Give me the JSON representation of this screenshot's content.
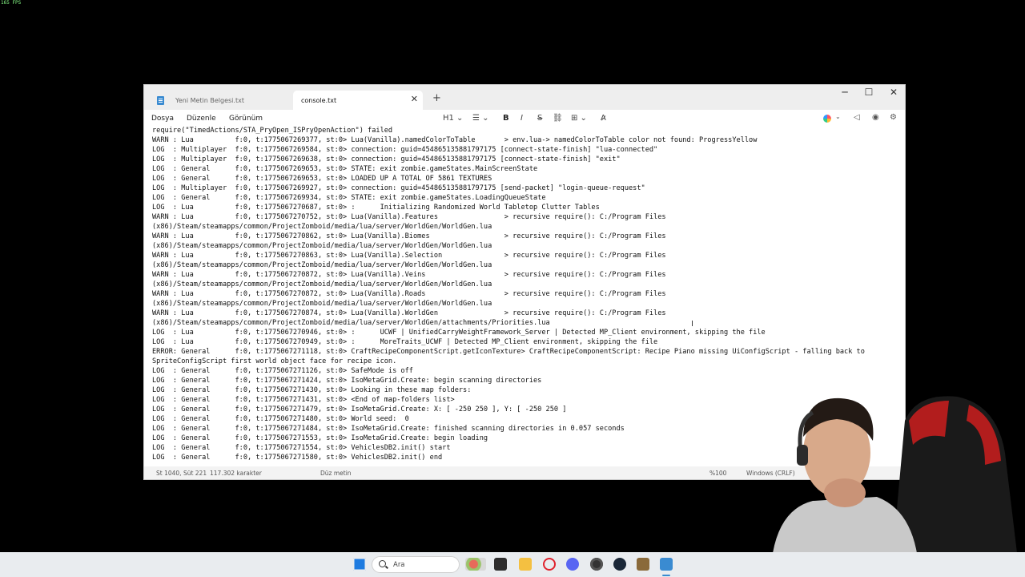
{
  "overlay": {
    "fps": "165 FPS"
  },
  "window": {
    "tabs": [
      {
        "label": "Yeni Metin Belgesi.txt",
        "active": false
      },
      {
        "label": "console.txt",
        "active": true
      }
    ],
    "new_tab_label": "+",
    "controls": {
      "minimize": "─",
      "maximize": "☐",
      "close": "✕"
    }
  },
  "menubar": {
    "items": [
      "Dosya",
      "Düzenle",
      "Görünüm"
    ],
    "toolbar": {
      "heading": "H1 ⌄",
      "list": "☰ ⌄",
      "bold": "B",
      "italic": "I",
      "strike": "S",
      "link": "⛓",
      "table": "⊞ ⌄",
      "clear_format": "A̷"
    },
    "right_icons": {
      "copilot_caret": "⌄",
      "feedback": "◁",
      "account": "◉",
      "settings": "⚙"
    }
  },
  "document": {
    "lines": [
      "require(\"TimedActions/STA_PryOpen_ISPryOpenAction\") failed",
      "WARN : Lua          f:0, t:1775067269377, st:0> Lua(Vanilla).namedColorToTable       > env.lua-> namedColorToTable color not found: ProgressYellow",
      "LOG  : Multiplayer  f:0, t:1775067269584, st:0> connection: guid=454865135881797175 [connect-state-finish] \"lua-connected\"",
      "LOG  : Multiplayer  f:0, t:1775067269638, st:0> connection: guid=454865135881797175 [connect-state-finish] \"exit\"",
      "LOG  : General      f:0, t:1775067269653, st:0> STATE: exit zombie.gameStates.MainScreenState",
      "LOG  : General      f:0, t:1775067269653, st:0> LOADED UP A TOTAL OF 5861 TEXTURES",
      "LOG  : Multiplayer  f:0, t:1775067269927, st:0> connection: guid=454865135881797175 [send-packet] \"login-queue-request\"",
      "LOG  : General      f:0, t:1775067269934, st:0> STATE: exit zombie.gameStates.LoadingQueueState",
      "LOG  : Lua          f:0, t:1775067270687, st:0> :      Initializing Randomized World Tabletop Clutter Tables",
      "WARN : Lua          f:0, t:1775067270752, st:0> Lua(Vanilla).Features                > recursive require(): C:/Program Files",
      "(x86)/Steam/steamapps/common/ProjectZomboid/media/lua/server/WorldGen/WorldGen.lua",
      "WARN : Lua          f:0, t:1775067270862, st:0> Lua(Vanilla).Biomes                  > recursive require(): C:/Program Files",
      "(x86)/Steam/steamapps/common/ProjectZomboid/media/lua/server/WorldGen/WorldGen.lua",
      "WARN : Lua          f:0, t:1775067270863, st:0> Lua(Vanilla).Selection               > recursive require(): C:/Program Files",
      "(x86)/Steam/steamapps/common/ProjectZomboid/media/lua/server/WorldGen/WorldGen.lua",
      "WARN : Lua          f:0, t:1775067270872, st:0> Lua(Vanilla).Veins                   > recursive require(): C:/Program Files",
      "(x86)/Steam/steamapps/common/ProjectZomboid/media/lua/server/WorldGen/WorldGen.lua",
      "WARN : Lua          f:0, t:1775067270872, st:0> Lua(Vanilla).Roads                   > recursive require(): C:/Program Files",
      "(x86)/Steam/steamapps/common/ProjectZomboid/media/lua/server/WorldGen/WorldGen.lua",
      "WARN : Lua          f:0, t:1775067270874, st:0> Lua(Vanilla).WorldGen                > recursive require(): C:/Program Files",
      "(x86)/Steam/steamapps/common/ProjectZomboid/media/lua/server/WorldGen/attachments/Priorities.lua",
      "LOG  : Lua          f:0, t:1775067270946, st:0> :      UCWF | UnifiedCarryWeightFramework_Server | Detected MP_Client environment, skipping the file",
      "LOG  : Lua          f:0, t:1775067270949, st:0> :      MoreTraits_UCWF | Detected MP_Client environment, skipping the file",
      "ERROR: General      f:0, t:1775067271118, st:0> CraftRecipeComponentScript.getIconTexture> CraftRecipeComponentScript: Recipe Piano missing UiConfigScript - falling back to",
      "SpriteConfigScript first world object face for recipe icon.",
      "LOG  : General      f:0, t:1775067271126, st:0> SafeMode is off",
      "LOG  : General      f:0, t:1775067271424, st:0> IsoMetaGrid.Create: begin scanning directories",
      "LOG  : General      f:0, t:1775067271430, st:0> Looking in these map folders:",
      "LOG  : General      f:0, t:1775067271431, st:0> <End of map-folders list>",
      "LOG  : General      f:0, t:1775067271479, st:0> IsoMetaGrid.Create: X: [ -250 250 ], Y: [ -250 250 ]",
      "LOG  : General      f:0, t:1775067271480, st:0> World seed:  0",
      "LOG  : General      f:0, t:1775067271484, st:0> IsoMetaGrid.Create: finished scanning directories in 0.057 seconds",
      "LOG  : General      f:0, t:1775067271553, st:0> IsoMetaGrid.Create: begin loading",
      "LOG  : General      f:0, t:1775067271554, st:0> VehiclesDB2.init() start",
      "LOG  : General      f:0, t:1775067271580, st:0> VehiclesDB2.init() end"
    ]
  },
  "statusbar": {
    "position": "St 1040, Süt 221",
    "char_count": "117.302 karakter",
    "format": "Düz metin",
    "zoom": "%100",
    "line_ending": "Windows (CRLF)"
  },
  "taskbar": {
    "search_placeholder": "Ara",
    "icons": [
      "windows-start-icon",
      "search-icon",
      "widget-icon",
      "terminal-icon",
      "file-explorer-icon",
      "opera-icon",
      "discord-icon",
      "obs-icon",
      "steam-icon",
      "game-icon",
      "notepad-icon"
    ],
    "colors": {
      "start": "#1e7be0",
      "explorer": "#f4c041",
      "opera": "#e0232e",
      "discord": "#5865f2",
      "steam": "#1b2838",
      "notepad": "#3a8bd1"
    }
  }
}
